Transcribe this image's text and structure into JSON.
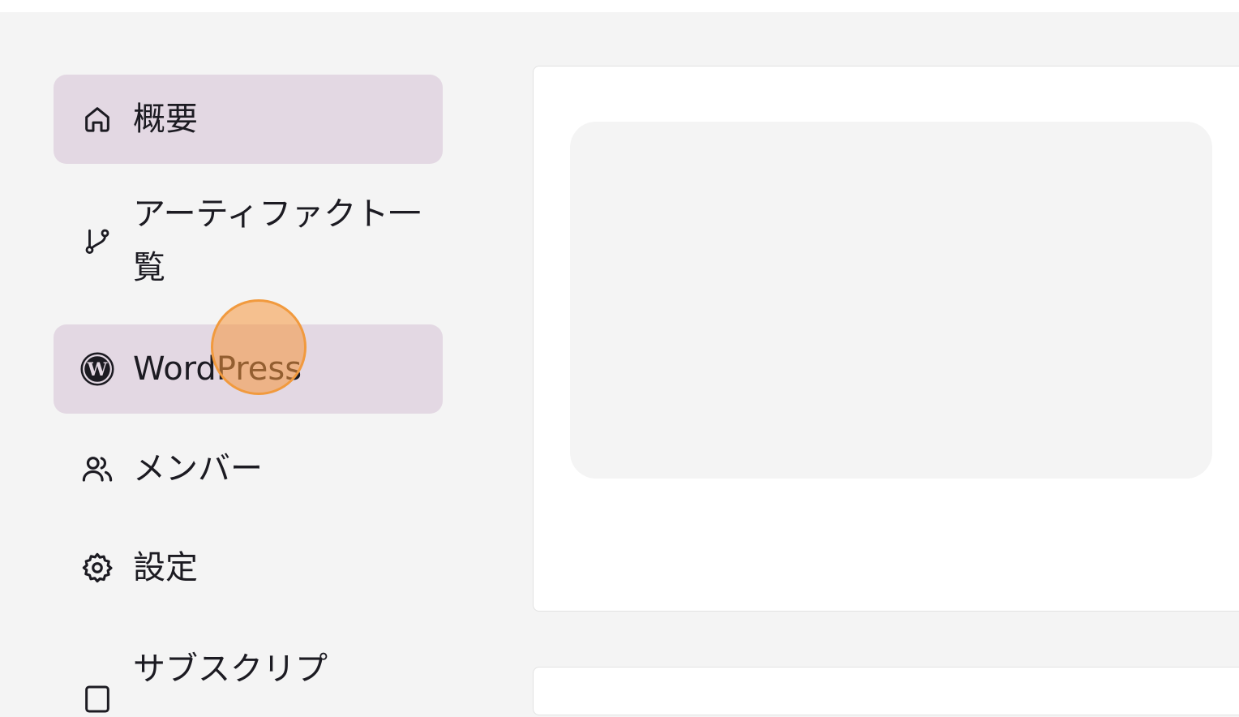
{
  "sidebar": {
    "items": [
      {
        "label": "概要",
        "icon": "home-icon",
        "active": true
      },
      {
        "label": "アーティファクト一覧",
        "icon": "git-branch-icon",
        "active": false
      },
      {
        "label": "WordPress",
        "icon": "wordpress-icon",
        "active": true
      },
      {
        "label": "メンバー",
        "icon": "users-icon",
        "active": false
      },
      {
        "label": "設定",
        "icon": "gear-icon",
        "active": false
      },
      {
        "label": "サブスクリプ",
        "icon": "card-icon",
        "active": false
      }
    ]
  },
  "colors": {
    "background": "#f4f4f4",
    "active_item": "#e3d8e3",
    "card": "#ffffff",
    "click_indicator": "#f19a3e"
  }
}
